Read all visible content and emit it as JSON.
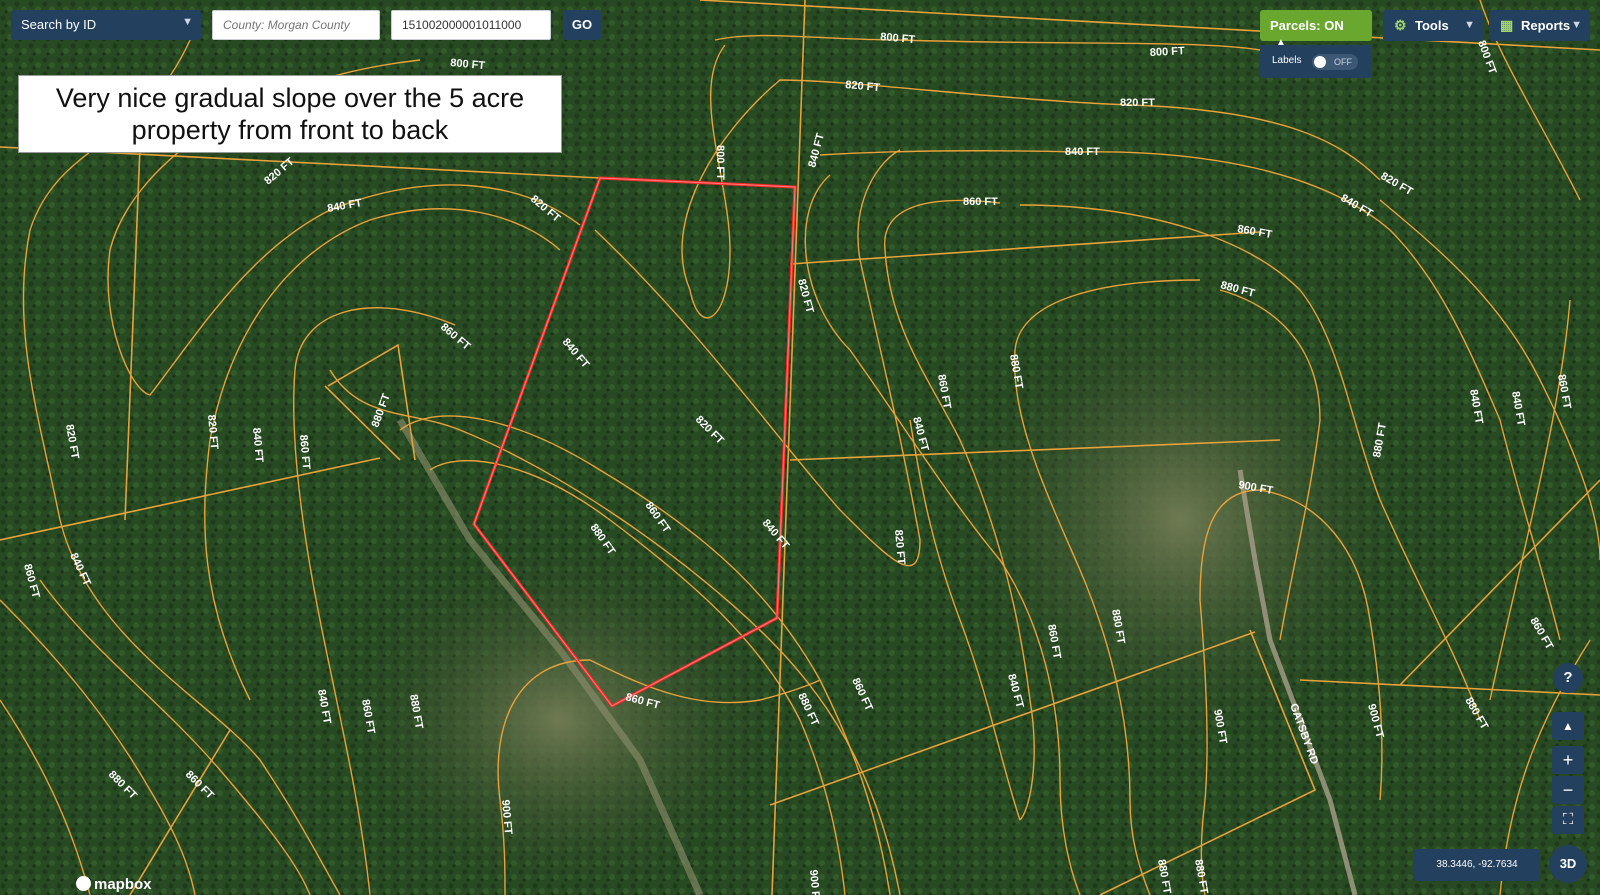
{
  "toolbar": {
    "search_type": "Search by ID",
    "county_placeholder": "County: Morgan County",
    "parcel_id_value": "151002000001011000",
    "go_label": "GO"
  },
  "annotation": {
    "text": "Very nice gradual slope over the 5 acre property from front to back"
  },
  "layers": {
    "parcels_label": "Parcels:",
    "parcels_state": "ON",
    "labels_label": "Labels",
    "labels_state": "OFF"
  },
  "menus": {
    "tools_label": "Tools",
    "reports_label": "Reports"
  },
  "map_controls": {
    "help": "?",
    "zoom_in": "+",
    "zoom_out": "−",
    "fullscreen": "⛶",
    "compass": "▲",
    "three_d": "3D",
    "coordinates": "38.3446, -92.7634",
    "attribution": "mapbox"
  },
  "contour_labels": [
    "800 FT",
    "820 FT",
    "840 FT",
    "860 FT",
    "880 FT",
    "900 FT"
  ],
  "road_label": "GATSBY RD",
  "colors": {
    "contour": "#e8a23a",
    "subject_parcel": "#ff2a2a",
    "panel": "#23405e",
    "parcels_on": "#6aa72f"
  }
}
